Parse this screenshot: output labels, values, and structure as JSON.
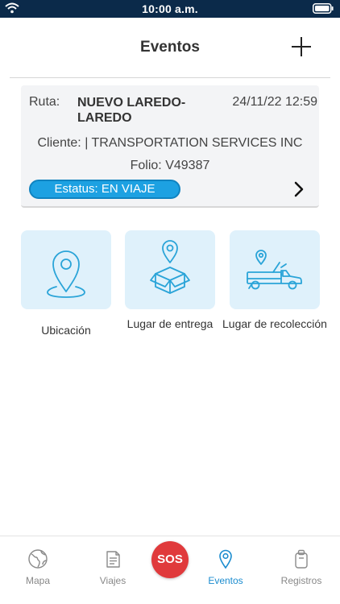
{
  "status_bar": {
    "time": "10:00 a.m."
  },
  "header": {
    "title": "Eventos"
  },
  "event_card": {
    "ruta_label": "Ruta:",
    "ruta_value": "NUEVO LAREDO-LAREDO",
    "date": "24/11/22 12:59",
    "cliente": "Cliente:  | TRANSPORTATION SERVICES INC",
    "folio": "Folio: V49387",
    "status": "Estatus: EN VIAJE"
  },
  "tiles": [
    {
      "label": "Ubicación",
      "icon": "location-pin-icon"
    },
    {
      "label": "Lugar de entrega",
      "icon": "delivery-box-icon"
    },
    {
      "label": "Lugar de recolección",
      "icon": "pickup-truck-icon"
    }
  ],
  "tabbar": {
    "items": [
      {
        "label": "Mapa",
        "icon": "globe-icon"
      },
      {
        "label": "Viajes",
        "icon": "document-icon"
      },
      {
        "label": "Eventos",
        "icon": "location-icon"
      },
      {
        "label": "Registros",
        "icon": "clipboard-icon"
      }
    ],
    "sos_label": "SOS"
  },
  "colors": {
    "status_bar": "#0b2a4a",
    "accent": "#1da1e2",
    "tile_bg": "#dff1fb",
    "icon_stroke": "#2aa4d8",
    "sos": "#e03a3c",
    "active_tab": "#1b8ccf"
  }
}
